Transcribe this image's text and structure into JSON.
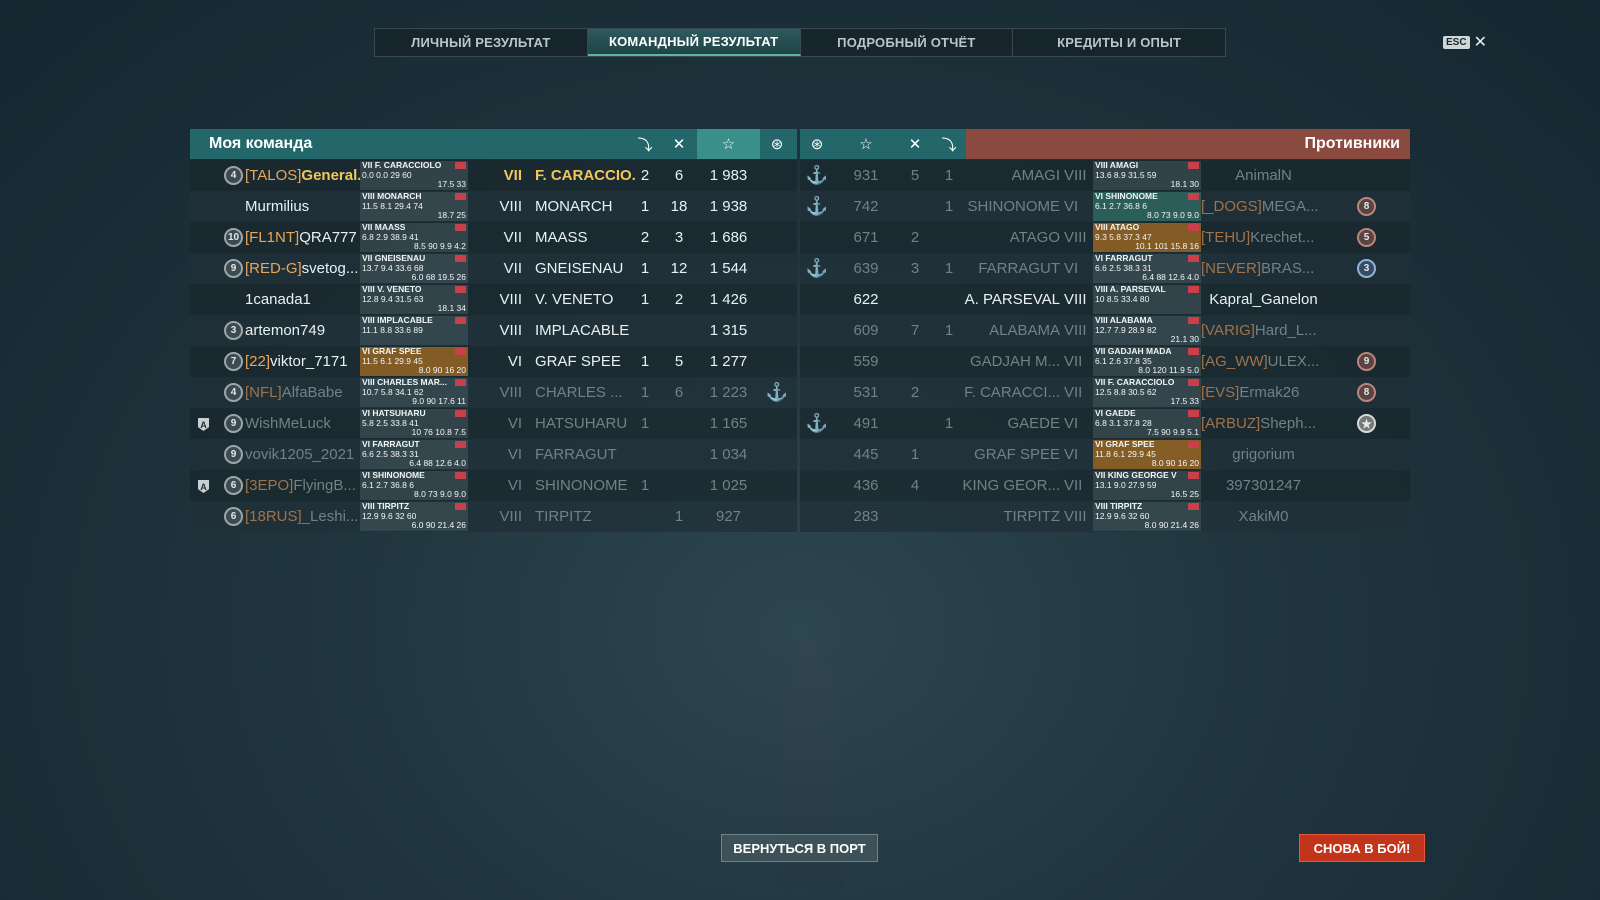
{
  "tabs": [
    {
      "label": "ЛИЧНЫЙ РЕЗУЛЬТАТ"
    },
    {
      "label": "КОМАНДНЫЙ РЕЗУЛЬТАТ"
    },
    {
      "label": "ПОДРОБНЫЙ ОТЧЁТ"
    },
    {
      "label": "КРЕДИТЫ И ОПЫТ"
    }
  ],
  "esc": {
    "key": "ESC",
    "close": "✕"
  },
  "my_team": {
    "title": "Моя команда",
    "header_icons": [
      "torpedo-icon",
      "kills-icon",
      "xp-star-icon",
      "capture-icon"
    ],
    "rows": [
      {
        "level": "4",
        "clan": "[TALOS]",
        "name": "General...",
        "card_line1": "VII F. CARACCIOLO",
        "card_line2": "0.0 0.0 29 60",
        "card_line3": "17.5 33",
        "tier": "VII",
        "ship": "F. CARACCIO...",
        "c1": "2",
        "c2": "6",
        "xp": "1 983",
        "anchor": "",
        "highlight": true
      },
      {
        "level": "",
        "clan": "",
        "name": "Murmilius",
        "card_line1": "VIII MONARCH",
        "card_line2": "11.5 8.1 29.4 74",
        "card_line3": "18.7 25",
        "tier": "VIII",
        "ship": "MONARCH",
        "c1": "1",
        "c2": "18",
        "xp": "1 938",
        "anchor": ""
      },
      {
        "level": "10",
        "clan": "[FL1NT]",
        "name": "QRA777",
        "card_line1": "VII MAASS",
        "card_line2": "6.8 2.9 38.9 41",
        "card_line3": "8.5 90 9.9 4.2",
        "tier": "VII",
        "ship": "MAASS",
        "c1": "2",
        "c2": "3",
        "xp": "1 686",
        "anchor": ""
      },
      {
        "level": "9",
        "clan": "[RED-G]",
        "name": "svetog...",
        "card_line1": "VII GNEISENAU",
        "card_line2": "13.7 9.4 33.6 68",
        "card_line3": "6.0 68 19.5 26",
        "tier": "VII",
        "ship": "GNEISENAU",
        "c1": "1",
        "c2": "12",
        "xp": "1 544",
        "anchor": ""
      },
      {
        "level": "",
        "clan": "",
        "name": "1canada1",
        "card_line1": "VIII V. VENETO",
        "card_line2": "12.8 9.4 31.5 63",
        "card_line3": "18.1 34",
        "tier": "VIII",
        "ship": "V. VENETO",
        "c1": "1",
        "c2": "2",
        "xp": "1 426",
        "anchor": ""
      },
      {
        "level": "3",
        "clan": "",
        "name": "artemon749",
        "card_line1": "VIII IMPLACABLE",
        "card_line2": "11.1 8.8 33.6 89",
        "card_line3": "",
        "tier": "VIII",
        "ship": "IMPLACABLE",
        "c1": "",
        "c2": "",
        "xp": "1 315",
        "anchor": ""
      },
      {
        "level": "7",
        "clan": "[22]",
        "name": "viktor_7171",
        "card_line1": "VI GRAF SPEE",
        "card_line2": "11.5 6.1 29.9 45",
        "card_line3": "8.0 90 16 20",
        "tier": "VI",
        "ship": "GRAF SPEE",
        "c1": "1",
        "c2": "5",
        "xp": "1 277",
        "anchor": "",
        "card": "orange"
      },
      {
        "level": "4",
        "clan": "[NFL]",
        "name": "AlfaBabe",
        "card_line1": "VIII CHARLES MAR...",
        "card_line2": "10.7 5.8 34.1 62",
        "card_line3": "9.0 90 17.6 11",
        "tier": "VIII",
        "ship": "CHARLES ...",
        "c1": "1",
        "c2": "6",
        "xp": "1 223",
        "anchor": "⚓",
        "dim": true
      },
      {
        "level": "9",
        "clan": "",
        "name": "WishMeLuck",
        "card_line1": "VI HATSUHARU",
        "card_line2": "5.8 2.5 33.8 41",
        "card_line3": "10 76 10.8 7.5",
        "tier": "VI",
        "ship": "HATSUHARU",
        "c1": "1",
        "c2": "",
        "xp": "1 165",
        "anchor": "",
        "dim": true,
        "aside": "A"
      },
      {
        "level": "9",
        "clan": "",
        "name": "vovik1205_2021",
        "card_line1": "VI FARRAGUT",
        "card_line2": "6.6 2.5 38.3 31",
        "card_line3": "6.4 88 12.6 4.0",
        "tier": "VI",
        "ship": "FARRAGUT",
        "c1": "",
        "c2": "",
        "xp": "1 034",
        "anchor": "",
        "dim": true
      },
      {
        "level": "6",
        "clan": "[3EPO]",
        "name": "FlyingB...",
        "card_line1": "VI SHINONOME",
        "card_line2": "6.1 2.7 36.8 6",
        "card_line3": "8.0 73 9.0 9.0",
        "tier": "VI",
        "ship": "SHINONOME",
        "c1": "1",
        "c2": "",
        "xp": "1 025",
        "anchor": "",
        "dim": true,
        "aside": "A"
      },
      {
        "level": "6",
        "clan": "[18RUS]",
        "name": "_Leshi...",
        "card_line1": "VIII TIRPITZ",
        "card_line2": "12.9 9.6 32 60",
        "card_line3": "6.0 90 21.4 26",
        "tier": "VIII",
        "ship": "TIRPITZ",
        "c1": "",
        "c2": "1",
        "xp": "927",
        "anchor": "",
        "dim": true
      }
    ]
  },
  "enemies": {
    "title": "Противники",
    "header_icons": [
      "capture-icon",
      "xp-star-icon",
      "kills-icon",
      "torpedo-icon"
    ],
    "rows": [
      {
        "anchor": "⚓",
        "xp": "931",
        "c2": "5",
        "c1": "1",
        "ship": "AMAGI",
        "tier": "VIII",
        "card_line1": "VIII AMAGI",
        "card_line2": "13.6 8.9 31.5 59",
        "card_line3": "18.1 30",
        "clan": "",
        "name": "AnimalN",
        "level": "",
        "dim": true
      },
      {
        "anchor": "⚓",
        "xp": "742",
        "c2": "",
        "c1": "1",
        "ship": "SHINONOME",
        "tier": "VI",
        "card_line1": "VI SHINONOME",
        "card_line2": "6.1 2.7 36.8 6",
        "card_line3": "8.0 73 9.0 9.0",
        "clan": "[_DOGS]",
        "name": "MEGA...",
        "level": "8",
        "card": "teal",
        "dim": true
      },
      {
        "anchor": "",
        "xp": "671",
        "c2": "2",
        "c1": "",
        "ship": "ATAGO",
        "tier": "VIII",
        "card_line1": "VIII ATAGO",
        "card_line2": "9.3 5.8 37.3 47",
        "card_line3": "10.1 101 15.8 16",
        "clan": "[TEHU]",
        "name": "Krechet...",
        "level": "5",
        "card": "orange",
        "dim": true
      },
      {
        "anchor": "⚓",
        "xp": "639",
        "c2": "3",
        "c1": "1",
        "ship": "FARRAGUT",
        "tier": "VI",
        "card_line1": "VI FARRAGUT",
        "card_line2": "6.6 2.5 38.3 31",
        "card_line3": "6.4 88 12.6 4.0",
        "clan": "[NEVER]",
        "name": "BRAS...",
        "level": "3",
        "dim": true,
        "blue": true
      },
      {
        "anchor": "",
        "xp": "622",
        "c2": "",
        "c1": "",
        "ship": "A. PARSEVAL",
        "tier": "VIII",
        "card_line1": "VIII A. PARSEVAL",
        "card_line2": "10 8.5 33.4 80",
        "card_line3": "",
        "clan": "",
        "name": "Kapral_Ganelon",
        "level": ""
      },
      {
        "anchor": "",
        "xp": "609",
        "c2": "7",
        "c1": "1",
        "ship": "ALABAMA",
        "tier": "VIII",
        "card_line1": "VIII ALABAMA",
        "card_line2": "12.7 7.9 28.9 82",
        "card_line3": "21.1 30",
        "clan": "[VARIG]",
        "name": "Hard_L...",
        "level": "",
        "dim": true
      },
      {
        "anchor": "",
        "xp": "559",
        "c2": "",
        "c1": "",
        "ship": "GADJAH M...",
        "tier": "VII",
        "card_line1": "VII GADJAH MADA",
        "card_line2": "6.1 2.6 37.8 35",
        "card_line3": "8.0 120 11.9 5.0",
        "clan": "[AG_WW]",
        "name": "ULEX...",
        "level": "9",
        "dim": true
      },
      {
        "anchor": "",
        "xp": "531",
        "c2": "2",
        "c1": "",
        "ship": "F. CARACCI...",
        "tier": "VII",
        "card_line1": "VII F. CARACCIOLO",
        "card_line2": "12.5 8.8 30.5 62",
        "card_line3": "17.5 33",
        "clan": "[EVS]",
        "name": "Ermak26",
        "level": "8",
        "dim": true
      },
      {
        "anchor": "⚓",
        "xp": "491",
        "c2": "",
        "c1": "1",
        "ship": "GAEDE",
        "tier": "VI",
        "card_line1": "VI GAEDE",
        "card_line2": "6.8 3.1 37.8 28",
        "card_line3": "7.5 90 9.9 5.1",
        "clan": "[ARBUZ]",
        "name": "Sheph...",
        "level": "★",
        "dim": true,
        "star": true
      },
      {
        "anchor": "",
        "xp": "445",
        "c2": "1",
        "c1": "",
        "ship": "GRAF SPEE",
        "tier": "VI",
        "card_line1": "VI GRAF SPEE",
        "card_line2": "11.8 6.1 29.9 45",
        "card_line3": "8.0 90 16 20",
        "clan": "",
        "name": "grigorium",
        "level": "",
        "dim": true,
        "card": "orange"
      },
      {
        "anchor": "",
        "xp": "436",
        "c2": "4",
        "c1": "",
        "ship": "KING GEOR...",
        "tier": "VII",
        "card_line1": "VII KING GEORGE V",
        "card_line2": "13.1 9.0 27.9 59",
        "card_line3": "16.5 25",
        "clan": "",
        "name": "397301247",
        "level": "",
        "dim": true
      },
      {
        "anchor": "",
        "xp": "283",
        "c2": "",
        "c1": "",
        "ship": "TIRPITZ",
        "tier": "VIII",
        "card_line1": "VIII TIRPITZ",
        "card_line2": "12.9 9.6 32 60",
        "card_line3": "8.0 90 21.4 26",
        "clan": "",
        "name": "XakiM0",
        "level": "",
        "dim": true
      }
    ]
  },
  "buttons": {
    "port": "ВЕРНУТЬСЯ В ПОРТ",
    "battle": "СНОВА В БОЙ!"
  }
}
